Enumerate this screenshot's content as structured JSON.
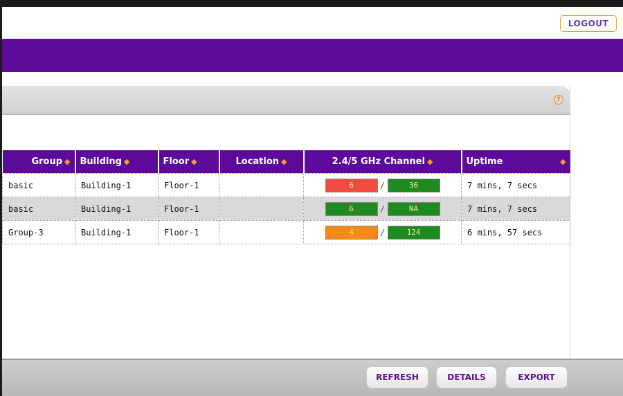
{
  "header": {
    "logout_label": "LOGOUT"
  },
  "help": {
    "icon": "help-icon",
    "glyph": "?"
  },
  "table": {
    "columns": [
      {
        "label": "Group"
      },
      {
        "label": "Building"
      },
      {
        "label": "Floor"
      },
      {
        "label": "Location"
      },
      {
        "label": "2.4/5 GHz Channel"
      },
      {
        "label": "Uptime"
      }
    ],
    "sort_glyph": "◆",
    "channel_separator": "/",
    "rows": [
      {
        "group": "basic",
        "building": "Building-1",
        "floor": "Floor-1",
        "location": "",
        "channel_24": "6",
        "channel_24_color": "#f24a40",
        "channel_5": "36",
        "channel_5_color": "#1f8a1f",
        "uptime": "7 mins, 7 secs"
      },
      {
        "group": "basic",
        "building": "Building-1",
        "floor": "Floor-1",
        "location": "",
        "channel_24": "6",
        "channel_24_color": "#1f8a1f",
        "channel_5": "NA",
        "channel_5_color": "#1f8a1f",
        "uptime": "7 mins, 7 secs"
      },
      {
        "group": "Group-3",
        "building": "Building-1",
        "floor": "Floor-1",
        "location": "",
        "channel_24": "4",
        "channel_24_color": "#f78a1c",
        "channel_5": "124",
        "channel_5_color": "#1f8a1f",
        "uptime": "6 mins, 57 secs"
      }
    ]
  },
  "footer": {
    "refresh_label": "REFRESH",
    "details_label": "DETAILS",
    "export_label": "EXPORT"
  },
  "colors": {
    "brand_purple": "#5c0a99",
    "accent_orange": "#e2a436"
  }
}
